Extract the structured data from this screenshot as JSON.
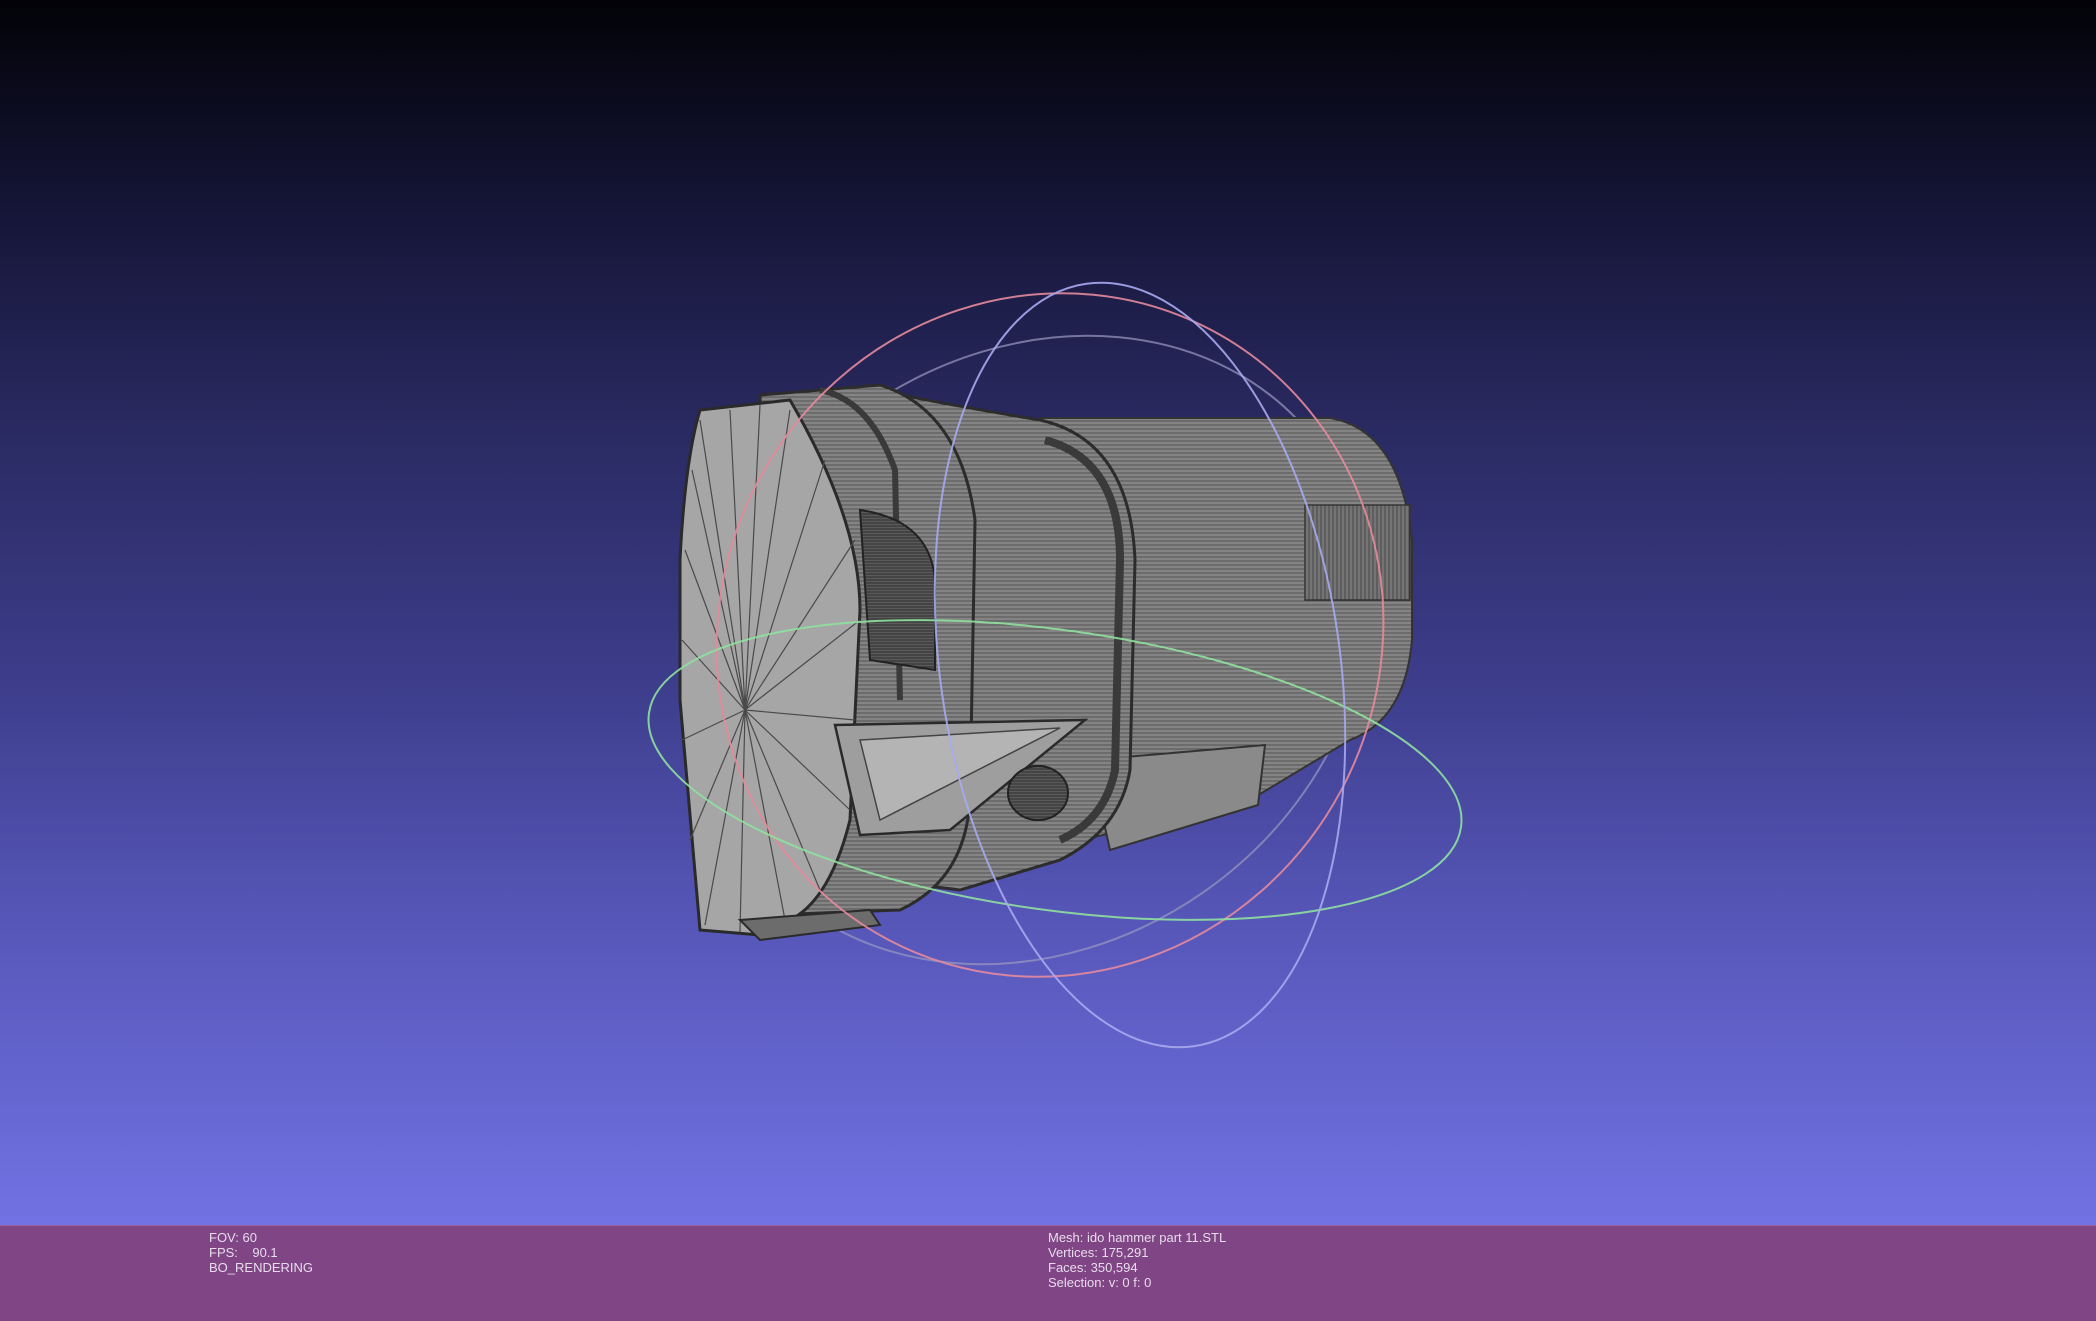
{
  "viewport": {
    "background_top": "#020207",
    "background_bottom": "#7272e4",
    "trackball_colors": {
      "x_ring": "#e48a9c",
      "y_ring": "#8fe0a0",
      "z_ring": "#a8a8f0",
      "outer_ring": "#9a9ac0"
    },
    "mesh_color": "#9c9c9c"
  },
  "info_bar": {
    "background": "#7f4585",
    "left": {
      "fov": "FOV: 60",
      "fps": "FPS:    90.1",
      "mode": "BO_RENDERING"
    },
    "right": {
      "mesh": "Mesh: ido hammer part 11.STL",
      "vertices": "Vertices: 175,291",
      "faces": "Faces: 350,594",
      "selection": "Selection: v: 0 f: 0"
    }
  }
}
